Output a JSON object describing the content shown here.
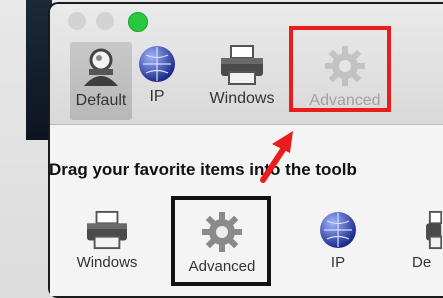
{
  "toolbar": {
    "items": [
      {
        "label": "Default",
        "icon": "user-icon"
      },
      {
        "label": "IP",
        "icon": "globe-icon"
      },
      {
        "label": "Windows",
        "icon": "printer-icon"
      },
      {
        "label": "Advanced",
        "icon": "gear-icon"
      }
    ]
  },
  "sheet": {
    "instruction": "Drag your favorite items into the toolb",
    "palette": [
      {
        "label": "Windows",
        "icon": "printer-icon"
      },
      {
        "label": "Advanced",
        "icon": "gear-icon"
      },
      {
        "label": "IP",
        "icon": "globe-icon"
      },
      {
        "label": "De",
        "icon": "printer-icon"
      }
    ]
  },
  "colors": {
    "highlight_red": "#ea1c1c",
    "highlight_black": "#111111"
  }
}
